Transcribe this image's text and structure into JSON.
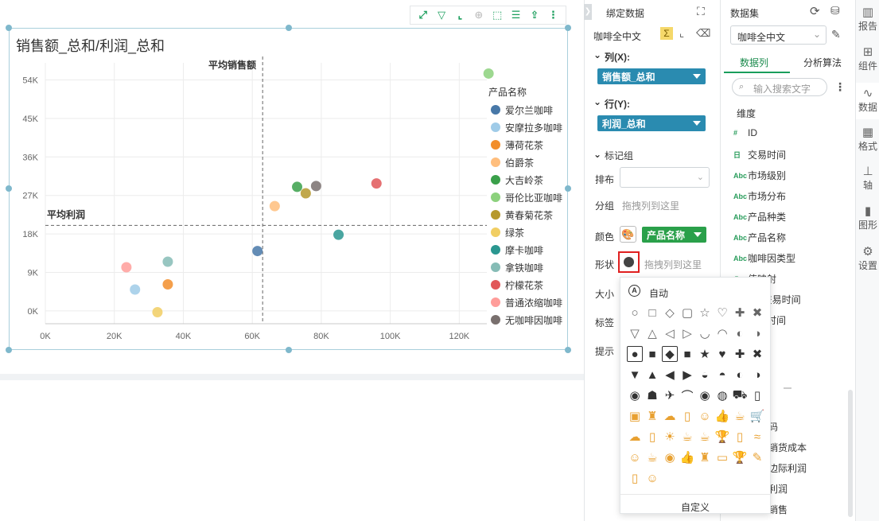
{
  "chart": {
    "title": "销售额_总和/利润_总和",
    "legend_title": "产品名称",
    "ref_x_label": "平均销售额",
    "ref_y_label": "平均利润"
  },
  "chart_data": {
    "type": "scatter",
    "title": "销售额_总和/利润_总和",
    "xlim": [
      0,
      128000
    ],
    "ylim": [
      -3000,
      58000
    ],
    "x_ticks": [
      "0K",
      "20K",
      "40K",
      "60K",
      "80K",
      "100K",
      "120K"
    ],
    "x_tick_values": [
      0,
      20000,
      40000,
      60000,
      80000,
      100000,
      120000
    ],
    "y_ticks": [
      "0K",
      "9K",
      "18K",
      "27K",
      "36K",
      "45K",
      "54K"
    ],
    "y_tick_values": [
      0,
      9000,
      18000,
      27000,
      36000,
      45000,
      54000
    ],
    "grid": true,
    "legend_position": "right",
    "reference_lines": {
      "x": 63000,
      "y": 20000
    },
    "series": [
      {
        "name": "爱尔兰咖啡",
        "color": "#4878a8",
        "x": 61500,
        "y": 14000
      },
      {
        "name": "安摩拉多咖啡",
        "color": "#9fcbe8",
        "x": 26000,
        "y": 5000
      },
      {
        "name": "薄荷花茶",
        "color": "#f28e2b",
        "x": 35500,
        "y": 6200
      },
      {
        "name": "伯爵茶",
        "color": "#ffbe7d",
        "x": 66500,
        "y": 24500
      },
      {
        "name": "大吉岭茶",
        "color": "#3aa04a",
        "x": 73000,
        "y": 29000
      },
      {
        "name": "哥伦比亚咖啡",
        "color": "#8cd17d",
        "x": 128500,
        "y": 55500
      },
      {
        "name": "黄春菊花茶",
        "color": "#b6992d",
        "x": 75500,
        "y": 27500
      },
      {
        "name": "绿茶",
        "color": "#f1ce63",
        "x": 32500,
        "y": -300
      },
      {
        "name": "摩卡咖啡",
        "color": "#2a9790",
        "x": 85000,
        "y": 17800
      },
      {
        "name": "拿铁咖啡",
        "color": "#86bcb6",
        "x": 35500,
        "y": 11500
      },
      {
        "name": "柠檬花茶",
        "color": "#e15759",
        "x": 96000,
        "y": 29800
      },
      {
        "name": "普通浓缩咖啡",
        "color": "#ff9d9a",
        "x": 23500,
        "y": 10200
      },
      {
        "name": "无咖啡因咖啡",
        "color": "#79706e",
        "x": 78500,
        "y": 29200
      }
    ]
  },
  "toolbar": {
    "icons": [
      "expand-icon",
      "filter-icon",
      "axis-icon",
      "zoom-icon",
      "select-icon",
      "list-icon",
      "export-icon",
      "more-icon"
    ]
  },
  "binding": {
    "header": "绑定数据",
    "dataset_name": "咖啡全中文",
    "columns_label": "列(X):",
    "columns_value": "销售额_总和",
    "rows_label": "行(Y):",
    "rows_value": "利润_总和",
    "mark_group": "标记组",
    "layout_label": "排布",
    "group_label": "分组",
    "group_placeholder": "拖拽列到这里",
    "color_label": "颜色",
    "color_value": "产品名称",
    "shape_label": "形状",
    "shape_placeholder": "拖拽列到这里",
    "size_label": "大小",
    "label_label": "标签",
    "tooltip_label": "提示"
  },
  "dataset": {
    "header": "数据集",
    "selected": "咖啡全中文",
    "tab_columns": "数据列",
    "tab_analysis": "分析算法",
    "search_placeholder": "输入搜索文字",
    "dimensions_label": "维度",
    "fields": [
      {
        "type": "#",
        "name": "ID"
      },
      {
        "type": "日",
        "name": "交易时间"
      },
      {
        "type": "Abc",
        "name": "市场级别"
      },
      {
        "type": "Abc",
        "name": "市场分布"
      },
      {
        "type": "Abc",
        "name": "产品种类"
      },
      {
        "type": "Abc",
        "name": "产品名称"
      },
      {
        "type": "Abc",
        "name": "咖啡因类型"
      },
      {
        "type": "◎",
        "name": "值映射"
      },
      {
        "type": "",
        "name": "年_交易时间"
      },
      {
        "type": "",
        "name": "交易时间"
      }
    ],
    "measures": [
      {
        "name": "码"
      },
      {
        "name": "销货成本"
      },
      {
        "name": "边际利润"
      },
      {
        "name": "利润"
      },
      {
        "name": "销售"
      }
    ]
  },
  "sidenav": {
    "items": [
      {
        "label": "报告",
        "icon": "report-icon"
      },
      {
        "label": "组件",
        "icon": "component-icon"
      },
      {
        "label": "数据",
        "icon": "data-icon"
      },
      {
        "label": "格式",
        "icon": "format-icon"
      },
      {
        "label": "轴",
        "icon": "axis-icon"
      },
      {
        "label": "图形",
        "icon": "graph-icon"
      },
      {
        "label": "设置",
        "icon": "settings-icon"
      }
    ]
  },
  "shape_picker": {
    "auto_label": "自动",
    "custom_label": "自定义"
  }
}
